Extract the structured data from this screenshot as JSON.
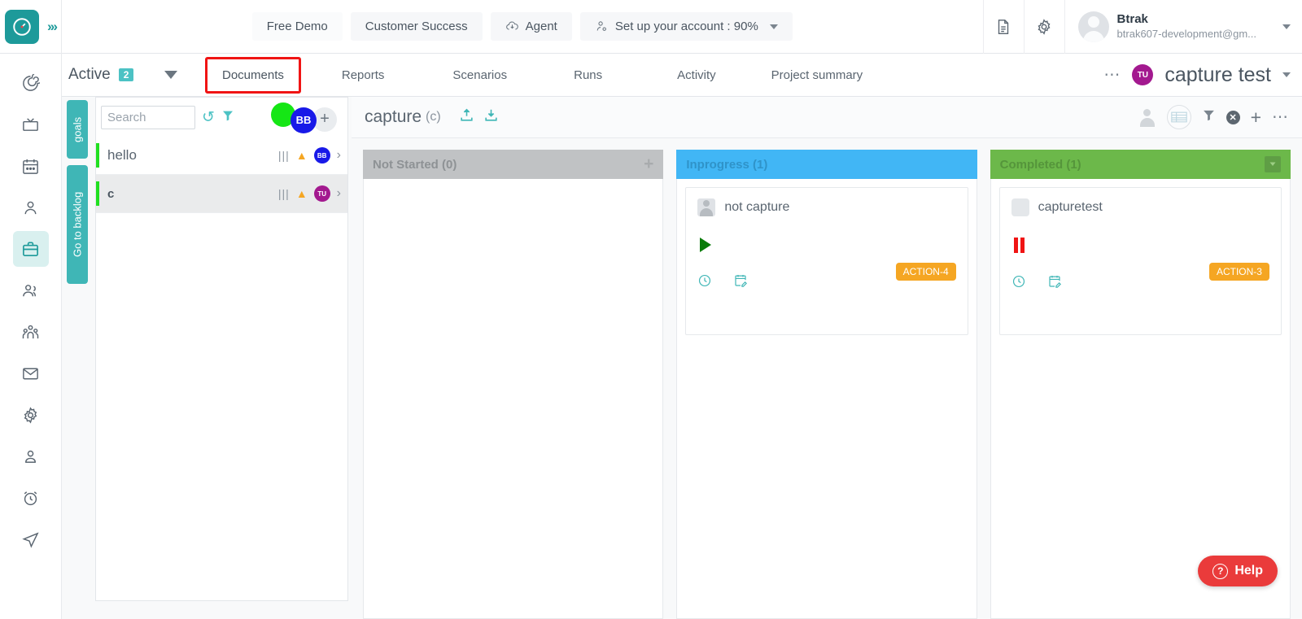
{
  "topbar": {
    "logo_icon": "clock-logo-icon",
    "expand_icon": "chevrons-right-icon",
    "nav_buttons": [
      {
        "label": "Free Demo",
        "icon": null
      },
      {
        "label": "Customer Success",
        "icon": null
      },
      {
        "label": "Agent",
        "icon": "cloud-download-icon"
      },
      {
        "label": "Set up your account : 90%",
        "icon": "user-gear-icon",
        "caret": true
      }
    ],
    "doc_icon": "document-icon",
    "settings_icon": "gear-icon",
    "profile": {
      "avatar_icon": "user-avatar",
      "name": "Btrak",
      "email": "btrak607-development@gm...",
      "caret_icon": "caret-down-icon"
    }
  },
  "subnav": {
    "active_label": "Active",
    "active_count": "2",
    "dropdown_icon": "triangle-down-icon",
    "tabs": [
      {
        "label": "Documents",
        "highlighted": true
      },
      {
        "label": "Reports",
        "highlighted": false
      },
      {
        "label": "Scenarios",
        "highlighted": false
      },
      {
        "label": "Runs",
        "highlighted": false
      },
      {
        "label": "Activity",
        "highlighted": false
      },
      {
        "label": "Project summary",
        "highlighted": false
      }
    ],
    "more_icon": "ellipsis-horizontal-icon",
    "project_badge": "TU",
    "project_name": "capture test",
    "project_caret": "caret-down-icon"
  },
  "rail": {
    "items": [
      {
        "icon": "spiral-icon",
        "active": false
      },
      {
        "icon": "tv-icon",
        "active": false
      },
      {
        "icon": "calendar-icon",
        "active": false
      },
      {
        "icon": "user-icon",
        "active": false
      },
      {
        "icon": "briefcase-icon",
        "active": true
      },
      {
        "icon": "users-icon",
        "active": false
      },
      {
        "icon": "team-icon",
        "active": false
      },
      {
        "icon": "mail-icon",
        "active": false
      },
      {
        "icon": "gear-icon",
        "active": false
      },
      {
        "icon": "contact-icon",
        "active": false
      },
      {
        "icon": "alarm-clock-icon",
        "active": false
      },
      {
        "icon": "send-icon",
        "active": false
      }
    ]
  },
  "leftpanel": {
    "vtabs": [
      {
        "label": "goals",
        "icon": "flag-icon"
      },
      {
        "label": "Go to backlog",
        "icon": "backlog-icon"
      }
    ],
    "search_placeholder": "Search",
    "search_value": "",
    "refresh_icon": "refresh-icon",
    "filter_icon": "filter-icon",
    "bubbles": {
      "green_dot": "status-green-dot",
      "initials": "BB",
      "add_icon": "plus-icon"
    },
    "rows": [
      {
        "label": "hello",
        "bold": false,
        "selected": false,
        "bars_icon": "bars-icon",
        "warn_icon": "warning-icon",
        "avatar": "BB",
        "avatar_color": "blue",
        "chevron": "chevron-right-icon"
      },
      {
        "label": "c",
        "bold": true,
        "selected": true,
        "bars_icon": "bars-icon",
        "warn_icon": "warning-icon",
        "avatar": "TU",
        "avatar_color": "purple",
        "chevron": "chevron-right-icon"
      }
    ]
  },
  "board": {
    "header": {
      "title": "capture",
      "subtitle": "(c)",
      "upload_icon": "upload-icon",
      "download_icon": "download-icon",
      "right_icons": [
        "person-gray-icon",
        "table-view-icon",
        "filter-icon",
        "close-circle-icon",
        "plus-icon",
        "ellipsis-horizontal-icon"
      ]
    },
    "columns": [
      {
        "title": "Not Started (0)",
        "style": "notstarted",
        "action_icon": "plus-icon",
        "cards": []
      },
      {
        "title": "Inprogress (1)",
        "style": "inprogress",
        "action_icon": null,
        "cards": [
          {
            "avatar_icon": "person-avatar-icon",
            "title": "not capture",
            "state_icon": "play-icon",
            "tag": "ACTION-4",
            "foot_icons": [
              "clock-icon",
              "calendar-edit-icon"
            ]
          }
        ]
      },
      {
        "title": "Completed (1)",
        "style": "completed",
        "action_icon": "collapse-icon",
        "cards": [
          {
            "avatar_icon": "blank-avatar-icon",
            "title": "capturetest",
            "state_icon": "pause-icon",
            "tag": "ACTION-3",
            "foot_icons": [
              "clock-icon",
              "calendar-edit-icon"
            ]
          }
        ]
      }
    ]
  },
  "help": {
    "label": "Help",
    "icon": "question-circle-icon"
  }
}
